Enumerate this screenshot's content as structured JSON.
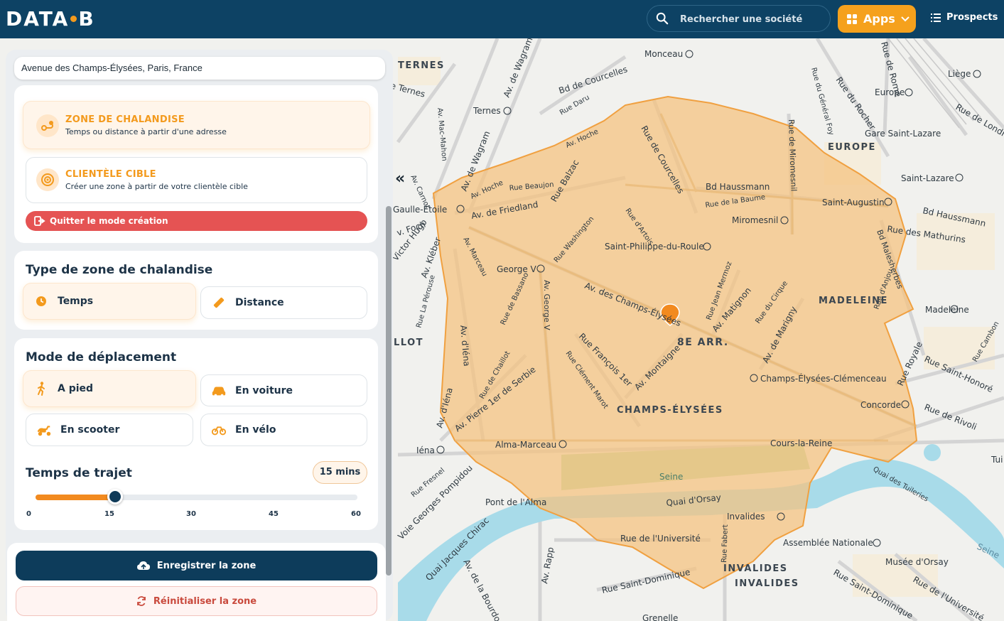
{
  "header": {
    "logo_left": "DATA",
    "logo_right": "B",
    "search_placeholder": "Rechercher une société",
    "apps_label": "Apps",
    "prospects_label": "Prospects"
  },
  "panel": {
    "address": "Avenue des Champs-Élysées, Paris, France",
    "modes": [
      {
        "title": "ZONE DE CHALANDISE",
        "subtitle": "Temps ou distance à partir d'une adresse",
        "icon": "route-icon"
      },
      {
        "title": "CLIENTÈLE CIBLE",
        "subtitle": "Créer une zone à partir de votre clientèle cible",
        "icon": "target-icon"
      }
    ],
    "quit_label": "Quitter le mode création",
    "zone_type": {
      "title": "Type de zone de chalandise",
      "options": [
        {
          "label": "Temps",
          "icon": "clock-icon",
          "active": true
        },
        {
          "label": "Distance",
          "icon": "ruler-icon",
          "active": false
        }
      ]
    },
    "travel_mode": {
      "title": "Mode de déplacement",
      "options": [
        {
          "label": "A pied",
          "icon": "walker-icon",
          "active": true
        },
        {
          "label": "En voiture",
          "icon": "car-icon",
          "active": false
        },
        {
          "label": "En scooter",
          "icon": "scooter-icon",
          "active": false
        },
        {
          "label": "En vélo",
          "icon": "bike-icon",
          "active": false
        }
      ]
    },
    "travel_time": {
      "title": "Temps de trajet",
      "badge": "15 mins",
      "value": 15,
      "min": 0,
      "max": 60,
      "ticks": [
        "0",
        "15",
        "30",
        "45",
        "60"
      ]
    },
    "save_label": "Enregistrer la zone",
    "reset_label": "Réinitialiser la zone"
  },
  "map": {
    "accent": "#f39a1d",
    "zone_fill": "#f5c27e",
    "labels": {
      "ternes": "TERNES",
      "europe": "EUROPE",
      "madeleine": "MADELEINE",
      "arr8": "8E ARR.",
      "champs": "CHAMPS-ÉLYSÉES",
      "invalides1": "INVALIDES",
      "invalides2": "INVALIDES",
      "chaillot": "LLOT",
      "seine1": "Seine",
      "seine2": "Seine"
    },
    "streets": {
      "courcelles_bd": "Bd de Courcelles",
      "wagram": "Av. de Wagram",
      "wagram2": "Av. de Wagram",
      "haussmann": "Bd Haussmann",
      "haussmann2": "Bd Haussmann",
      "baume": "Rue de la Baume",
      "miromesnil_rue": "Rue de Miromesnil",
      "courcelles_rue": "Rue de Courcelles",
      "balzac": "Rue Balzac",
      "friedland": "Av. de Friedland",
      "hoche": "Av. Hoche",
      "beaujon": "Rue Beaujon",
      "artois": "Rue d'Artois",
      "washington": "Rue Washington",
      "champs_av": "Av. des Champs-Élysées",
      "montaigne": "Av. Montaigne",
      "matignon": "Av. Matignon",
      "marigny": "Av. de Marigny",
      "francois": "Rue François 1er",
      "clement": "Rue Clément Marot",
      "serbie": "Av. Pierre 1er de Serbie",
      "chaillot_rue": "Rue de Chaillot",
      "iena": "Av. d'Iéna",
      "iena2": "Av. d'Iéna",
      "georgev": "Av. George V",
      "bassano": "Rue de Bassano",
      "marceau": "Av. Marceau",
      "kleber": "Av. Kléber",
      "victorhugo": "Victor Hugo",
      "foch": "v. Foch",
      "perouse": "Rue La Pérouse",
      "royale": "Rue Royale",
      "sthonore": "Rue Saint-Honoré",
      "rivoli": "Rue de Rivoli",
      "tuileries": "Quai des Tuileries",
      "quaiorsay": "Quai d'Orsay",
      "universite": "Rue de l'Université",
      "universite2": "Rue de l'Université",
      "stdominique": "Rue Saint-Dominique",
      "stdominique2": "Rue Saint-Dominique",
      "rapp": "Av. Rapp",
      "bourdonnais": "Av. de la Bourdonnais",
      "jacqueschirac": "Quai Jacques Chirac",
      "pompidou": "Voie Georges Pompidou",
      "fresnel": "Rue Fresnel",
      "fabert": "Rue Fabert",
      "malesherbes": "Bd Malesherbes",
      "mathurins": "Rue des Mathurins",
      "rocher": "Rue du Rocher",
      "rome": "Rue de Rome",
      "londres": "Rue de Londr",
      "cirque": "Rue du Cirque",
      "mermoz": "Rue Jean Mermoz",
      "terne_rue": "Rue Ternes",
      "carnot": "Av. Carnot",
      "macmahon": "Av. Mac-Mahon",
      "daru": "Rue Daru",
      "anjou": "Rue d'Anjou",
      "gfoy": "Rue du Général Foy",
      "cambon": "Rue Cambon"
    },
    "stations": {
      "monceau": "Monceau",
      "liege": "Liège",
      "europe": "Europe",
      "stlazare_gare": "Gare Saint-Lazare",
      "stlazare": "Saint-Lazare",
      "staugustin": "Saint-Augustin",
      "ternes": "Ternes",
      "etoile": "Gaulle-Étoile",
      "miromesnil": "Miromesnil",
      "stphilippe": "Saint-Philippe-du-Roule",
      "georgev": "George V",
      "madeleine": "Madeleine",
      "ce_clem": "Champs-Élysées-Clémenceau",
      "concorde": "Concorde",
      "iena": "Iéna",
      "alma": "Alma-Marceau",
      "cours_reine": "Cours-la-Reine",
      "pont_alma": "Pont de l'Alma",
      "invalides": "Invalides",
      "assemblee": "Assemblée Nationale",
      "orsay": "Musée d'Orsay",
      "grenelle": "Grenelle",
      "tui": "Tui"
    }
  }
}
